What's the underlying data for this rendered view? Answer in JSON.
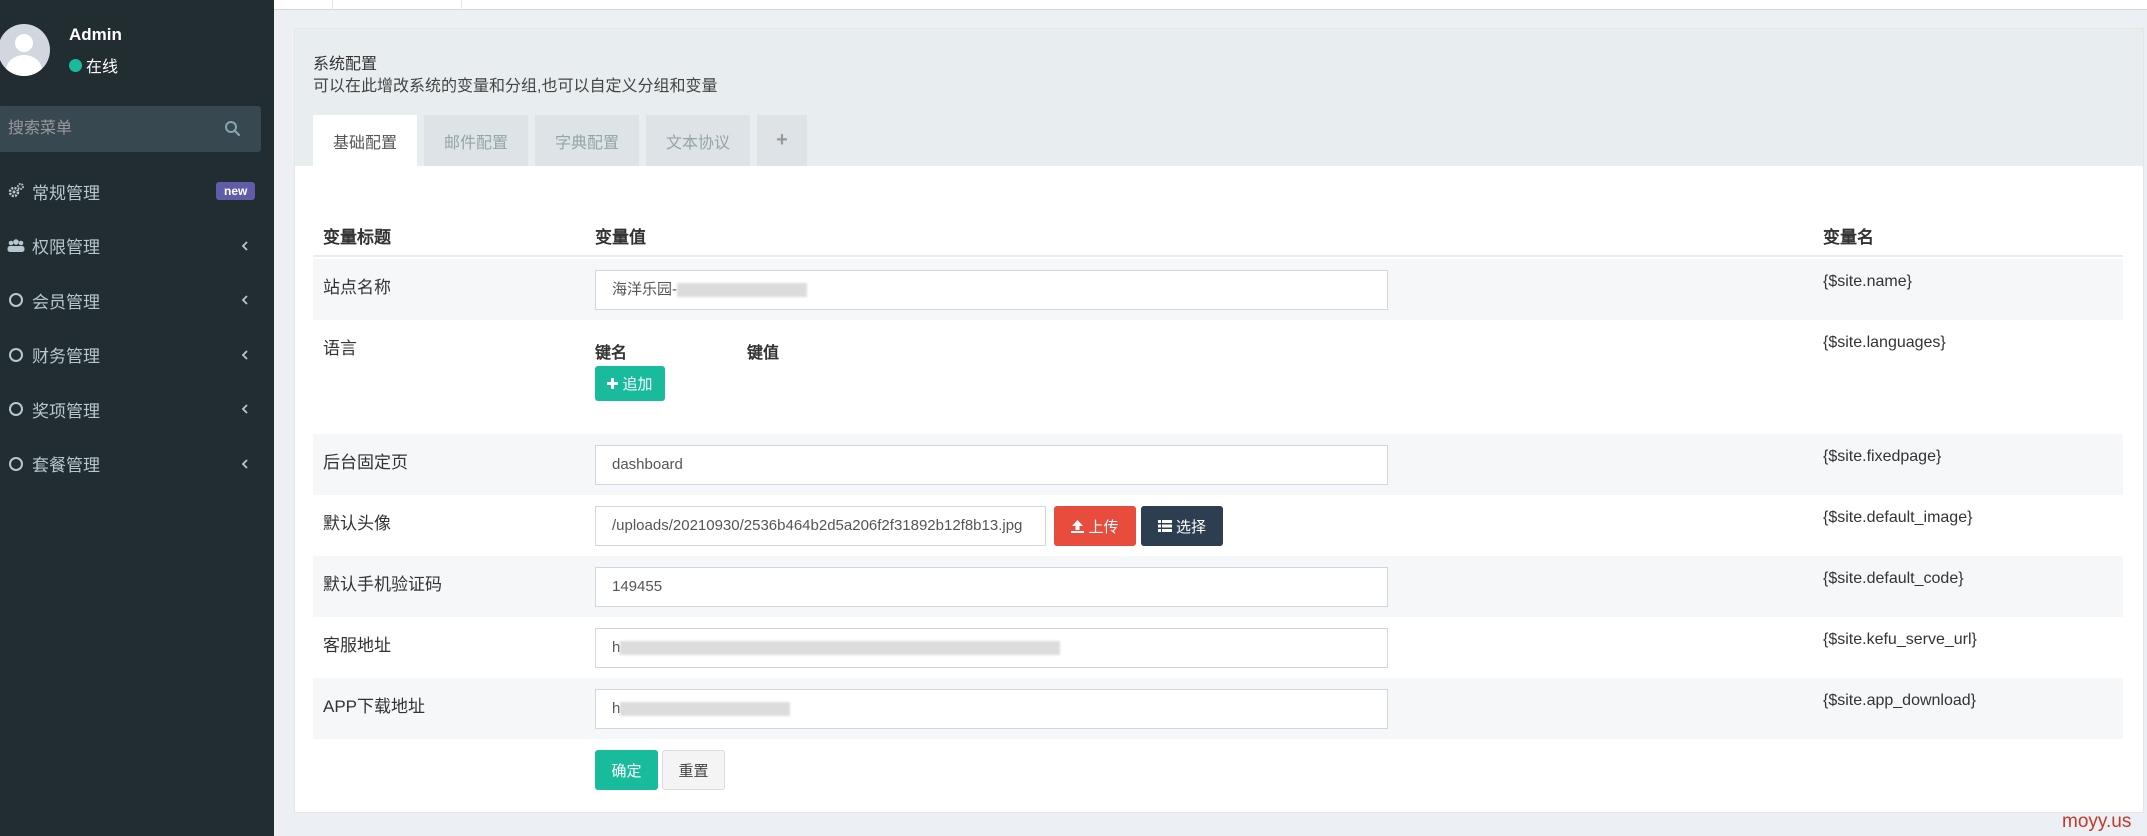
{
  "user": {
    "name": "Admin",
    "status": "在线"
  },
  "search": {
    "placeholder": "搜索菜单"
  },
  "menu": [
    {
      "label": "常规管理",
      "icon": "cogs-icon",
      "badge": "new"
    },
    {
      "label": "权限管理",
      "icon": "group-icon"
    },
    {
      "label": "会员管理",
      "icon": "circle-o-icon"
    },
    {
      "label": "财务管理",
      "icon": "circle-o-icon"
    },
    {
      "label": "奖项管理",
      "icon": "circle-o-icon"
    },
    {
      "label": "套餐管理",
      "icon": "circle-o-icon"
    }
  ],
  "panel": {
    "title": "系统配置",
    "description": "可以在此增改系统的变量和分组,也可以自定义分组和变量"
  },
  "tabs": [
    "基础配置",
    "邮件配置",
    "字典配置",
    "文本协议",
    "+"
  ],
  "table": {
    "headers": {
      "title": "变量标题",
      "value": "变量值",
      "name": "变量名"
    },
    "rows": [
      {
        "title": "站点名称",
        "value": "海洋乐园-",
        "var": "{$site.name}"
      },
      {
        "title": "语言",
        "key_label": "键名",
        "value_label": "键值",
        "add_label": "追加",
        "var": "{$site.languages}"
      },
      {
        "title": "后台固定页",
        "value": "dashboard",
        "var": "{$site.fixedpage}"
      },
      {
        "title": "默认头像",
        "value": "/uploads/20210930/2536b464b2d5a206f2f31892b12f8b13.jpg",
        "upload_label": "上传",
        "choose_label": "选择",
        "var": "{$site.default_image}"
      },
      {
        "title": "默认手机验证码",
        "value": "149455",
        "var": "{$site.default_code}"
      },
      {
        "title": "客服地址",
        "value": "h",
        "var": "{$site.kefu_serve_url}"
      },
      {
        "title": "APP下载地址",
        "value": "h",
        "var": "{$site.app_download}"
      }
    ]
  },
  "actions": {
    "confirm": "确定",
    "reset": "重置"
  },
  "watermark": "moyy.us"
}
